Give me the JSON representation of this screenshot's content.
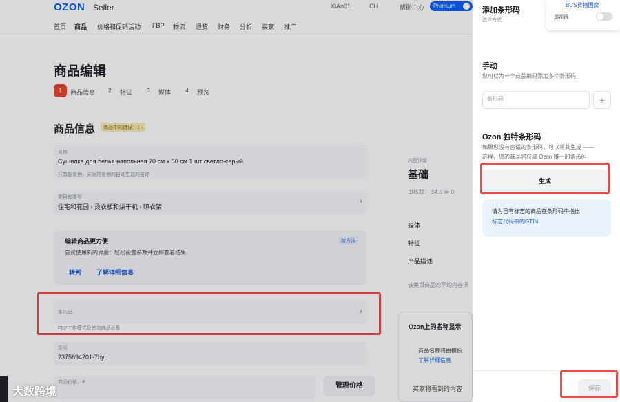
{
  "header": {
    "logo": "OZON",
    "logo_sub": "Seller",
    "user": "XiAn01",
    "currency": "CH",
    "help": "帮助中心",
    "premium": "Premium"
  },
  "nav": [
    "首页",
    "商品",
    "价格和促销活动",
    "FBP",
    "物流",
    "退货",
    "财务",
    "分析",
    "买家",
    "推广"
  ],
  "page": {
    "title": "商品编辑",
    "steps": [
      {
        "num": "1",
        "label": "商品信息"
      },
      {
        "num": "2",
        "label": "特征"
      },
      {
        "num": "3",
        "label": "媒体"
      },
      {
        "num": "4",
        "label": "预览"
      }
    ],
    "section_title": "商品信息",
    "section_badge": "商品中的错误：1 ›",
    "name_field": {
      "label": "名称",
      "value": "Сушилка для белья напольная 70 см х 50 см 1 шт светло-серый",
      "hint": "只有能看到，买家将看到的自动生成的名称"
    },
    "category_field": {
      "label": "类目和类型",
      "value": "住宅和花园 › 烫衣板和烘干机 › 晾衣架"
    },
    "promo": {
      "title": "编辑商品更方便",
      "text": "尝试使用新的界面：轻松设置参数并立即查看结果",
      "new_badge": "新方法",
      "link_switch": "转到",
      "link_more": "了解详细信息"
    },
    "barcode_field": {
      "label": "条形码",
      "hint": "FBP工作模式及首次商品必备"
    },
    "sku_field": {
      "label": "货号",
      "value": "2375694201-7hyu"
    },
    "price_field_label": "商品价格，₽",
    "manage_price": "管理价格",
    "content": {
      "label": "内容评级",
      "value": "基础",
      "score": "审核版：  54.5 ≫ 0",
      "items": [
        "媒体",
        "特征",
        "产品描述"
      ],
      "footer": "该类目商品的平均内容评"
    },
    "name_card": {
      "title": "Ozon上的名称显示",
      "text": "商品名称将由模板",
      "link": "了解详细信息",
      "bottom": "买家将看到的内容"
    }
  },
  "drawer": {
    "title": "添加条形码",
    "subtitle": "选择方式",
    "bcs": {
      "title": "BCS货物国度",
      "label": "透视镜"
    },
    "manual": {
      "title": "手动",
      "desc": "您可以为一个商品编码添加多个条形码",
      "placeholder": "条形码"
    },
    "ozon": {
      "title": "Ozon 独特条形码",
      "desc_line1": "如果您没有合适的条形码，可以将其生成 ——",
      "desc_line2": "这样，您的商品将获取 Ozon 唯一的条形码",
      "button": "生成"
    },
    "info": {
      "text": "请为已有标志的商品在条形码中指出",
      "link": "标志代码中的GTIN"
    },
    "save": "保存"
  },
  "watermark": {
    "text": "大数跨境"
  }
}
